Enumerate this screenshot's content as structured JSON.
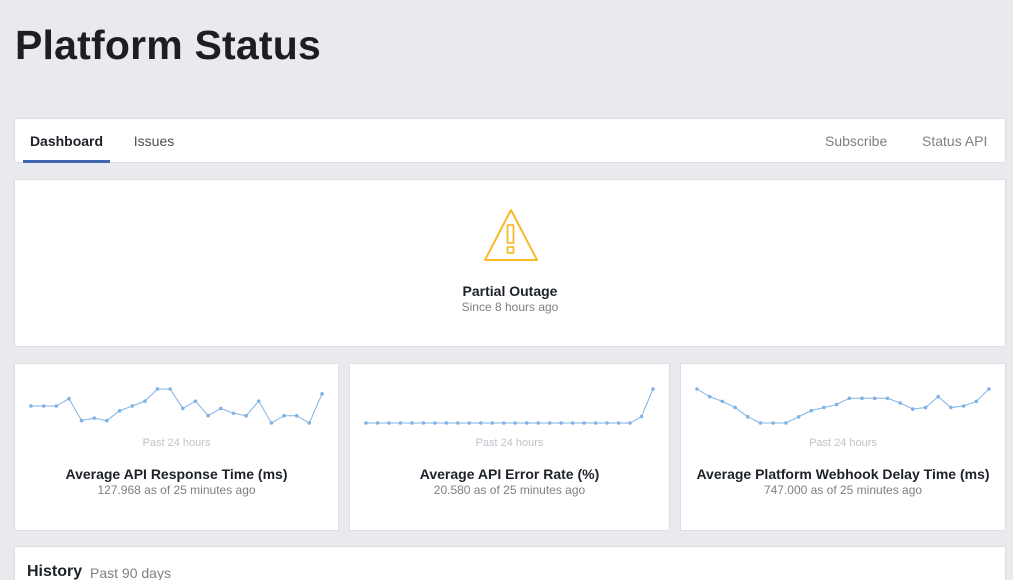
{
  "page": {
    "title": "Platform Status"
  },
  "nav": {
    "tabs": [
      {
        "label": "Dashboard",
        "active": true
      },
      {
        "label": "Issues",
        "active": false
      }
    ],
    "links": [
      "Subscribe",
      "Status API"
    ]
  },
  "status": {
    "icon": "warning-triangle-icon",
    "title": "Partial Outage",
    "since": "Since 8 hours ago",
    "color": "#f7b928"
  },
  "metrics": [
    {
      "period": "Past 24 hours",
      "title": "Average API Response Time (ms)",
      "value": "127.968 as of 25 minutes ago",
      "series": [
        123,
        123,
        123,
        126,
        117,
        118,
        117,
        121,
        123,
        125,
        130,
        130,
        122,
        125,
        119,
        122,
        120,
        119,
        125,
        116,
        119,
        119,
        116,
        128
      ]
    },
    {
      "period": "Past 24 hours",
      "title": "Average API Error Rate (%)",
      "value": "20.580 as of 25 minutes ago",
      "series": [
        1,
        1,
        1,
        1,
        1,
        1,
        1,
        1,
        1,
        1,
        1,
        1,
        1,
        1,
        1,
        1,
        1,
        1,
        1,
        1,
        1,
        1,
        1,
        1,
        5,
        22
      ]
    },
    {
      "period": "Past 24 hours",
      "title": "Average Platform Webhook Delay Time (ms)",
      "value": "747.000 as of 25 minutes ago",
      "series": [
        760,
        755,
        752,
        748,
        742,
        738,
        738,
        738,
        742,
        746,
        748,
        750,
        754,
        754,
        754,
        754,
        751,
        747,
        748,
        755,
        748,
        749,
        752,
        760
      ]
    }
  ],
  "history": {
    "title": "History",
    "subtitle": "Past 90 days"
  },
  "colors": {
    "accent": "#4267b2",
    "sparkline": "#7fb3e6",
    "background": "#e9eaee"
  }
}
